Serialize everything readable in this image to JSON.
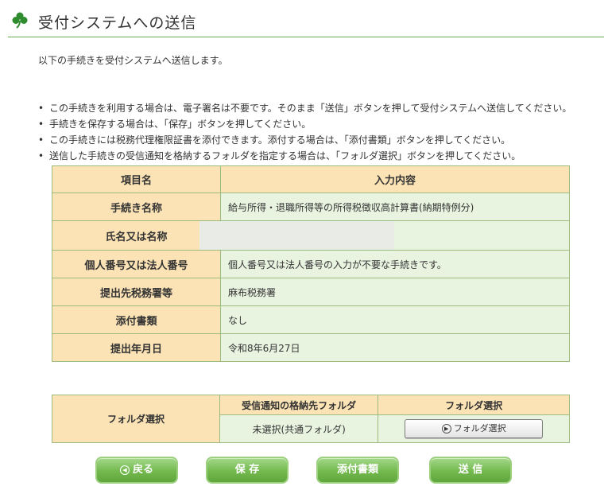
{
  "header": {
    "title": "受付システムへの送信",
    "icon": "clover-icon",
    "accent": "#2e8b2e"
  },
  "intro": "以下の手続きを受付システムへ送信します。",
  "notes": [
    "この手続きを利用する場合は、電子署名は不要です。そのまま「送信」ボタンを押して受付システムへ送信してください。",
    "手続きを保存する場合は、「保存」ボタンを押してください。",
    "この手続きには税務代理権限証書を添付できます。添付する場合は、「添付書類」ボタンを押してください。",
    "送信した手続きの受信通知を格納するフォルダを指定する場合は、「フォルダ選択」ボタンを押してください。"
  ],
  "info_table": {
    "headers": [
      "項目名",
      "入力内容"
    ],
    "rows": [
      {
        "label": "手続き名称",
        "value": "給与所得・退職所得等の所得税徴収高計算書(納期特例分)"
      },
      {
        "label": "氏名又は名称",
        "value": ""
      },
      {
        "label": "個人番号又は法人番号",
        "value": "個人番号又は法人番号の入力が不要な手続きです。"
      },
      {
        "label": "提出先税務署等",
        "value": "麻布税務署"
      },
      {
        "label": "添付書類",
        "value": "なし"
      },
      {
        "label": "提出年月日",
        "value": "令和8年6月27日"
      }
    ]
  },
  "folder_table": {
    "row_label": "フォルダ選択",
    "col_headers": [
      "受信通知の格納先フォルダ",
      "フォルダ選択"
    ],
    "folder_value": "未選択(共通フォルダ)",
    "button_label": "フォルダ選択"
  },
  "buttons": {
    "back": "戻る",
    "save": "保 存",
    "attach": "添付書類",
    "send": "送 信"
  },
  "colors": {
    "table_header_bg": "#fbe3b5",
    "table_cell_bg": "#e8f3e0",
    "button_green": "#73b94e"
  }
}
